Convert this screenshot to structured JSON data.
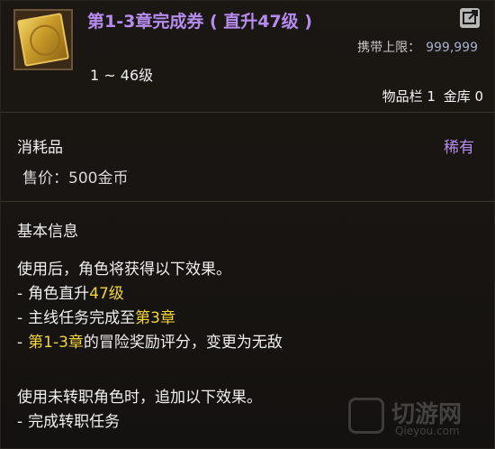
{
  "item": {
    "title": "第1-3章完成券 ( 直升47级 )",
    "carry_limit_label": "携带上限：",
    "carry_limit_value": "999,999",
    "level_range": "1 ~ 46级",
    "inventory_label": "物品栏 1",
    "warehouse_label": "金库 0"
  },
  "category": {
    "type": "消耗品",
    "rarity": "稀有",
    "price_label": "售价：",
    "price_value": "500金币"
  },
  "info": {
    "title": "基本信息",
    "line1": "使用后，角色将获得以下效果。",
    "l2_dash": "-",
    "l2_text": "角色直升",
    "l2_hl": "47级",
    "l3_dash": "-",
    "l3_text": "主线任务完成至",
    "l3_hl": "第3章",
    "l4_dash": "-",
    "l4_hl": "第1-3章",
    "l4_text": "的冒险奖励评分，变更为无敌",
    "line5": "使用未转职角色时，追加以下效果。",
    "l6_dash": "-",
    "l6_text": "完成转职任务"
  },
  "watermark": {
    "cn": "切游网",
    "en": "Qieyou.com"
  },
  "colors": {
    "rare": "#b78cf0",
    "highlight": "#f2d43b"
  },
  "icons": {
    "share": "share-icon",
    "item": "ticket-icon"
  }
}
